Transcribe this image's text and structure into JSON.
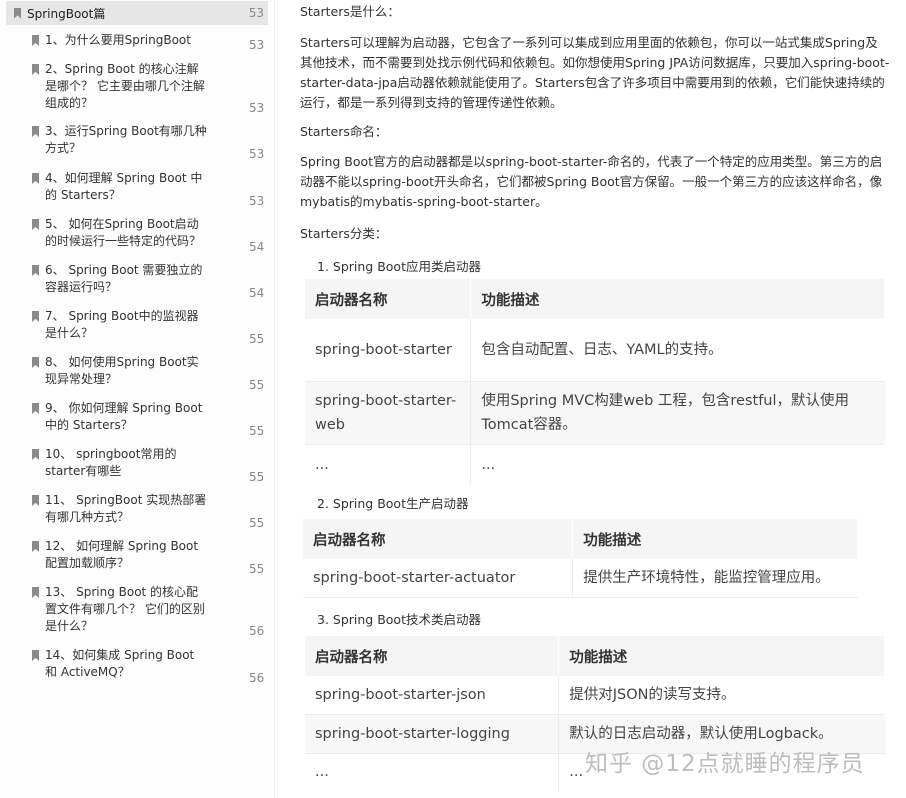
{
  "sidebar": {
    "title": "SpringBoot篇",
    "title_page": "53",
    "items": [
      {
        "text": "1、为什么要用SpringBoot",
        "page": "53"
      },
      {
        "text": "2、Spring Boot 的核心注解是哪个？ 它主要由哪几个注解组成的？",
        "page": "53"
      },
      {
        "text": "3、运行Spring Boot有哪几种方式？",
        "page": "53"
      },
      {
        "text": "4、如何理解 Spring Boot 中的 Starters？",
        "page": "53"
      },
      {
        "text": "5、 如何在Spring Boot启动的时候运行一些特定的代码？",
        "page": "54"
      },
      {
        "text": "6、 Spring Boot 需要独立的容器运行吗？",
        "page": "54"
      },
      {
        "text": "7、 Spring Boot中的监视器是什么？",
        "page": "55"
      },
      {
        "text": "8、 如何使用Spring Boot实现异常处理？",
        "page": "55"
      },
      {
        "text": "9、 你如何理解 Spring Boot中的 Starters？",
        "page": "55"
      },
      {
        "text": "10、 springboot常用的starter有哪些",
        "page": "55"
      },
      {
        "text": "11、 SpringBoot 实现热部署有哪几种方式？",
        "page": "55"
      },
      {
        "text": "12、 如何理解 Spring Boot 配置加载顺序？",
        "page": "55"
      },
      {
        "text": "13、 Spring Boot 的核心配置文件有哪几个？ 它们的区别是什么？",
        "page": "56"
      },
      {
        "text": "14、如何集成 Spring Boot 和 ActiveMQ？",
        "page": "56"
      }
    ]
  },
  "content": {
    "h1": "Starters是什么：",
    "p1": "Starters可以理解为启动器，它包含了一系列可以集成到应用里面的依赖包，你可以一站式集成Spring及其他技术，而不需要到处找示例代码和依赖包。如你想使用Spring JPA访问数据库，只要加入spring-boot-starter-data-jpa启动器依赖就能使用了。Starters包含了许多项目中需要用到的依赖，它们能快速持续的运行，都是一系列得到支持的管理传递性依赖。",
    "h2": "Starters命名：",
    "p2": "Spring Boot官方的启动器都是以spring-boot-starter-命名的，代表了一个特定的应用类型。第三方的启动器不能以spring-boot开头命名，它们都被Spring Boot官方保留。一般一个第三方的应该这样命名，像mybatis的mybatis-spring-boot-starter。",
    "h3": "Starters分类：",
    "sec1": "1. Spring Boot应用类启动器",
    "sec2": "2. Spring Boot生产启动器",
    "sec3": "3. Spring Boot技术类启动器",
    "col_name": "启动器名称",
    "col_desc": "功能描述",
    "t1": [
      {
        "name": "spring-boot-starter",
        "desc": "包含自动配置、日志、YAML的支持。"
      },
      {
        "name": "spring-boot-starter-web",
        "desc": "使用Spring MVC构建web 工程，包含restful，默认使用Tomcat容器。"
      },
      {
        "name": "...",
        "desc": "..."
      }
    ],
    "t2": [
      {
        "name": "spring-boot-starter-actuator",
        "desc": "提供生产环境特性，能监控管理应用。"
      }
    ],
    "t3": [
      {
        "name": "spring-boot-starter-json",
        "desc": "提供对JSON的读写支持。"
      },
      {
        "name": "spring-boot-starter-logging",
        "desc": "默认的日志启动器，默认使用Logback。"
      },
      {
        "name": "...",
        "desc": "..."
      }
    ]
  },
  "watermark": "知乎 @12点就睡的程序员"
}
